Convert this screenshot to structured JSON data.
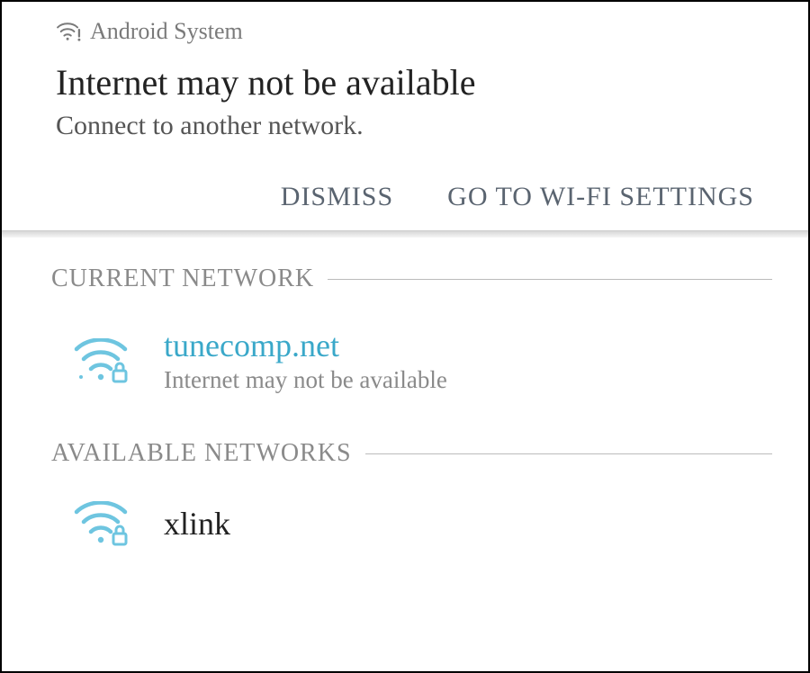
{
  "notification": {
    "source": "Android System",
    "title": "Internet may not be available",
    "subtitle": "Connect to another network.",
    "dismiss_label": "DISMISS",
    "settings_label": "GO TO WI-FI SETTINGS"
  },
  "wifi": {
    "current_section_label": "CURRENT NETWORK",
    "available_section_label": "AVAILABLE NETWORKS",
    "current": {
      "name": "tunecomp.net",
      "status": "Internet may not be available"
    },
    "available": [
      {
        "name": "xlink"
      }
    ]
  }
}
